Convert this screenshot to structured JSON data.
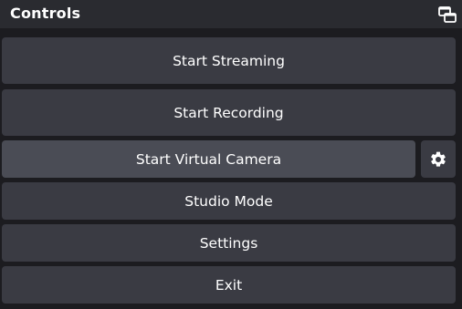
{
  "dock": {
    "title": "Controls",
    "float_icon": "undock-icon"
  },
  "controls": {
    "start_streaming": "Start Streaming",
    "start_recording": "Start Recording",
    "start_virtual_camera": "Start Virtual Camera",
    "virtual_camera_settings_icon": "gear-icon",
    "studio_mode": "Studio Mode",
    "settings": "Settings",
    "exit": "Exit"
  }
}
